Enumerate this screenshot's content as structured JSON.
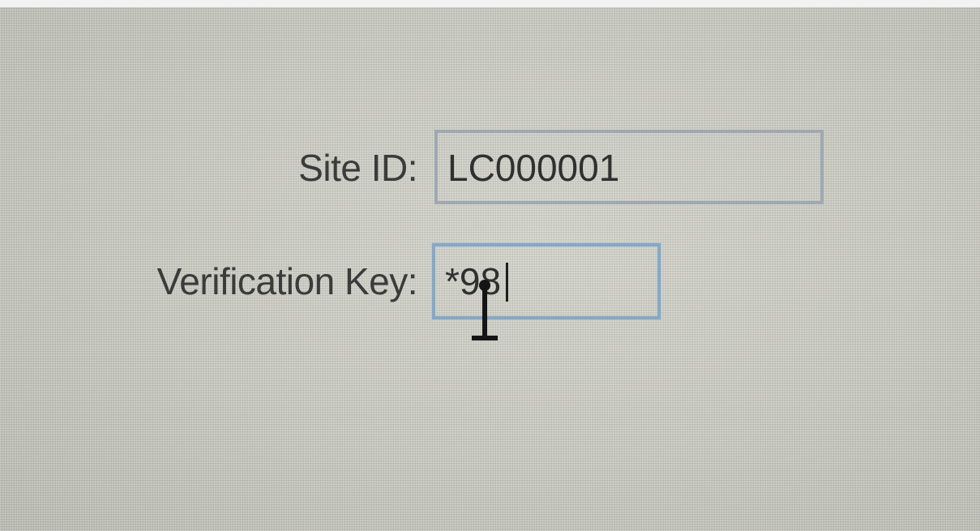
{
  "form": {
    "site_id_label": "Site ID:",
    "site_id_value": "LC000001",
    "verification_key_label": "Verification Key:",
    "verification_key_value": "*98"
  }
}
